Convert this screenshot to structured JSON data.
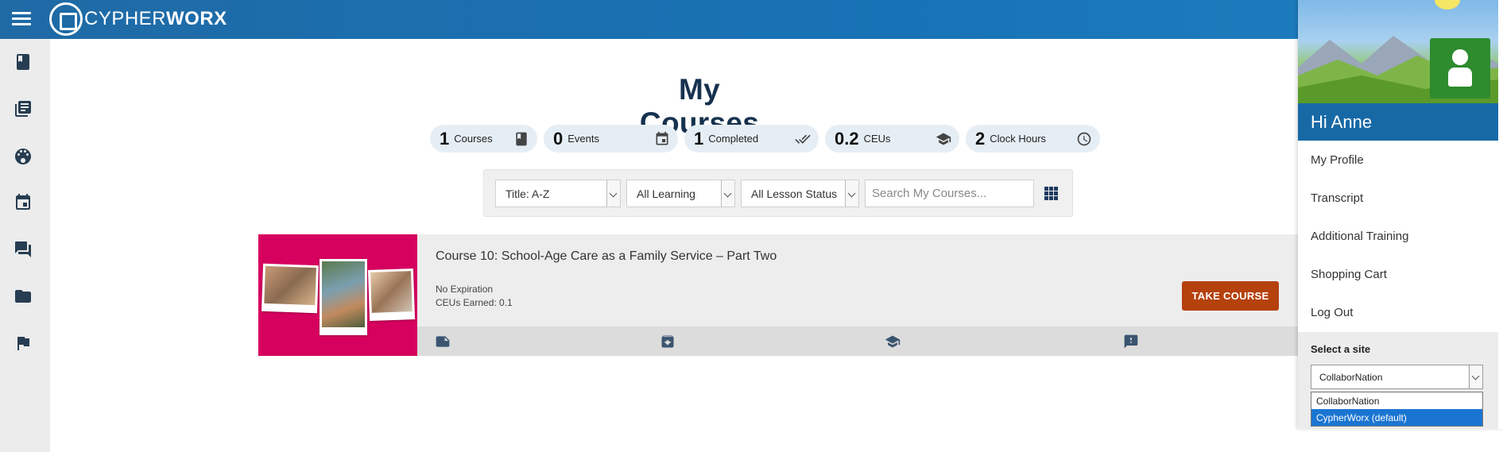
{
  "header": {
    "logo_text_light": "CYPHER",
    "logo_text_bold": "WORX"
  },
  "left_rail": {
    "items": [
      {
        "icon": "book-icon"
      },
      {
        "icon": "library-books-icon"
      },
      {
        "icon": "explore-icon"
      },
      {
        "icon": "calendar-icon"
      },
      {
        "icon": "forum-icon"
      },
      {
        "icon": "folder-icon"
      },
      {
        "icon": "flag-icon"
      }
    ]
  },
  "main": {
    "title": "My Courses",
    "stats": [
      {
        "value": "1",
        "label": "Courses",
        "icon": "book-icon"
      },
      {
        "value": "0",
        "label": "Events",
        "icon": "calendar-icon"
      },
      {
        "value": "1",
        "label": "Completed",
        "icon": "double-check-icon"
      },
      {
        "value": "0.2",
        "label": "CEUs",
        "icon": "graduation-cap-icon"
      },
      {
        "value": "2",
        "label": "Clock Hours",
        "icon": "clock-icon"
      }
    ],
    "filters": {
      "sort": "Title: A-Z",
      "type": "All Learning",
      "status": "All Lesson Status",
      "search_placeholder": "Search My Courses..."
    },
    "course": {
      "title": "Course 10: School-Age Care as a Family Service – Part Two",
      "expiration": "No Expiration",
      "ceus": "CEUs Earned: 0.1",
      "button": "TAKE COURSE",
      "footer_icons": [
        "note-icon",
        "archive-download-icon",
        "graduation-cap-icon",
        "feedback-icon"
      ]
    }
  },
  "profile_panel": {
    "greeting": "Hi Anne",
    "menu": [
      "My Profile",
      "Transcript",
      "Additional Training",
      "Shopping Cart",
      "Log Out"
    ],
    "site_label": "Select a site",
    "site_selected": "CollaborNation",
    "site_options": [
      "CollaborNation",
      "CypherWorx (default)"
    ],
    "site_highlighted": "CypherWorx (default)"
  },
  "colors": {
    "topbar": "#1873b6",
    "title": "#16324f",
    "course_thumb": "#d6005e",
    "take_button": "#b5410d",
    "panel_header": "#1769a6",
    "avatar": "#2e8b2e"
  }
}
